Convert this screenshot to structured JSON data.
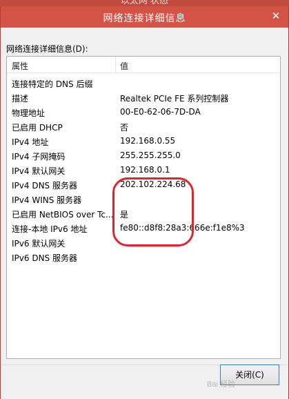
{
  "background_window": {
    "title": "以太网 状态"
  },
  "dialog": {
    "title": "网络连接详细信息",
    "close_glyph": "✕",
    "list_label": "网络连接详细信息(D):",
    "columns": [
      "属性",
      "值"
    ],
    "rows": [
      {
        "property": "连接特定的 DNS 后缀",
        "value": ""
      },
      {
        "property": "描述",
        "value": "Realtek PCIe FE 系列控制器"
      },
      {
        "property": "物理地址",
        "value": "00-E0-62-06-7D-DA"
      },
      {
        "property": "已启用 DHCP",
        "value": "否"
      },
      {
        "property": "IPv4 地址",
        "value": "192.168.0.55"
      },
      {
        "property": "IPv4 子网掩码",
        "value": "255.255.255.0"
      },
      {
        "property": "IPv4 默认网关",
        "value": "192.168.0.1"
      },
      {
        "property": "IPv4 DNS 服务器",
        "value": "202.102.224.68"
      },
      {
        "property": "IPv4 WINS 服务器",
        "value": ""
      },
      {
        "property": "已启用 NetBIOS over Tc...",
        "value": "是"
      },
      {
        "property": "连接-本地 IPv6 地址",
        "value": "fe80::d8f8:28a3:666e:f1e8%3"
      },
      {
        "property": "IPv6 默认网关",
        "value": ""
      },
      {
        "property": "IPv6 DNS 服务器",
        "value": ""
      }
    ],
    "close_button": "关闭(C)"
  },
  "watermark": "Bai 经验",
  "colors": {
    "title_bar": "#d35447",
    "annotation": "#e0242c"
  }
}
